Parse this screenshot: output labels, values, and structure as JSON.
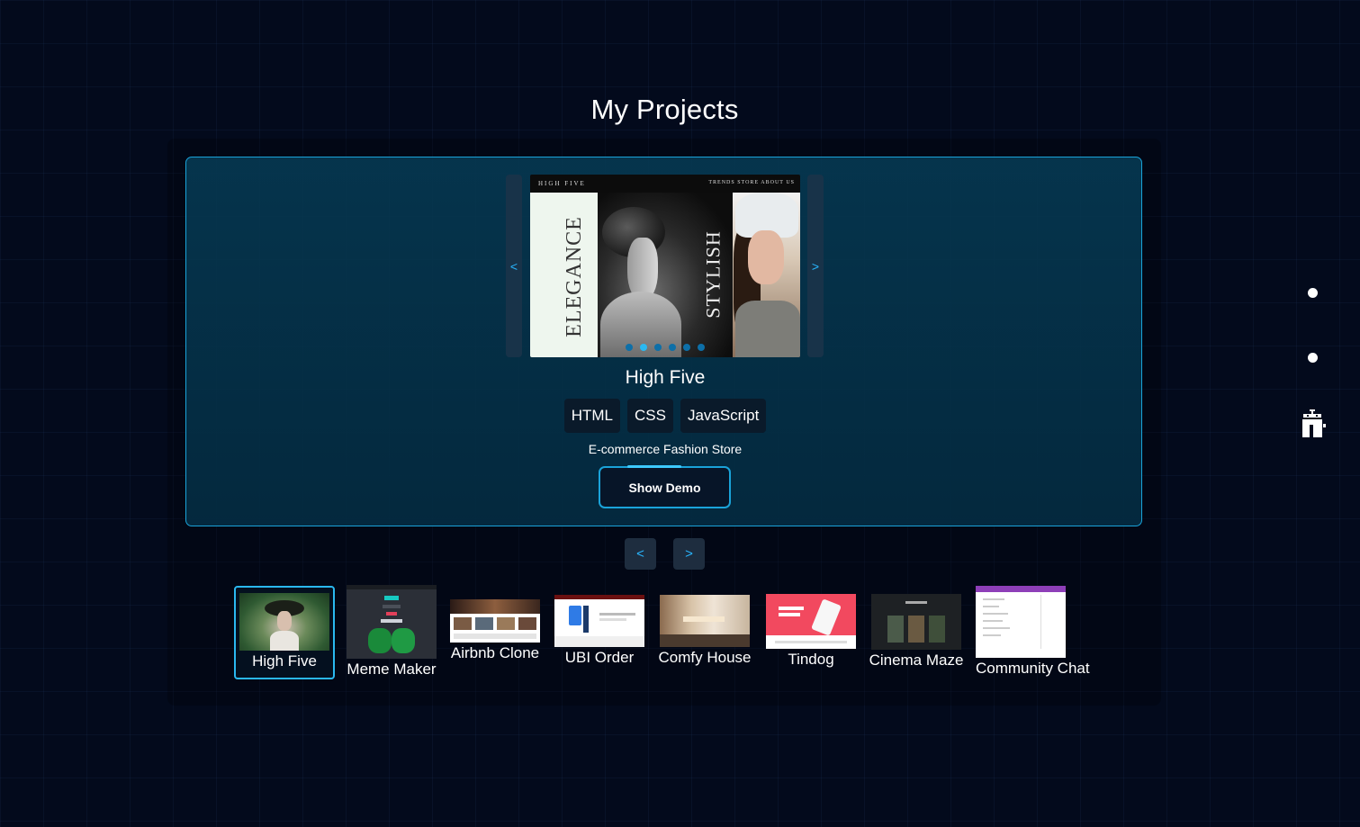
{
  "page": {
    "title": "My Projects"
  },
  "carousel": {
    "prev_label": "<",
    "next_label": ">",
    "slide_count": 6,
    "active_slide": 2,
    "preview": {
      "brand": "HIGH FIVE",
      "nav": "TRENDS  STORE  ABOUT US",
      "left_word": "ELEGANCE",
      "right_word": "STYLISH"
    }
  },
  "project": {
    "name": "High Five",
    "tags": [
      "HTML",
      "CSS",
      "JavaScript"
    ],
    "description": "E-commerce Fashion Store",
    "demo_label": "Show Demo"
  },
  "pager": {
    "prev_label": "<",
    "next_label": ">"
  },
  "thumbnails": [
    {
      "label": "High Five",
      "selected": true
    },
    {
      "label": "Meme Maker",
      "selected": false
    },
    {
      "label": "Airbnb Clone",
      "selected": false
    },
    {
      "label": "UBI Order",
      "selected": false
    },
    {
      "label": "Comfy House",
      "selected": false
    },
    {
      "label": "Tindog",
      "selected": false
    },
    {
      "label": "Cinema Maze",
      "selected": false
    },
    {
      "label": "Community Chat",
      "selected": false
    }
  ],
  "colors": {
    "background": "#030a1c",
    "accent": "#1aa3d9",
    "card": "#063c56",
    "button_bg": "#071528"
  },
  "icons": {
    "side_prev": "chevron-left-icon",
    "side_next": "chevron-right-icon",
    "rail_bottom": "robot-icon"
  }
}
